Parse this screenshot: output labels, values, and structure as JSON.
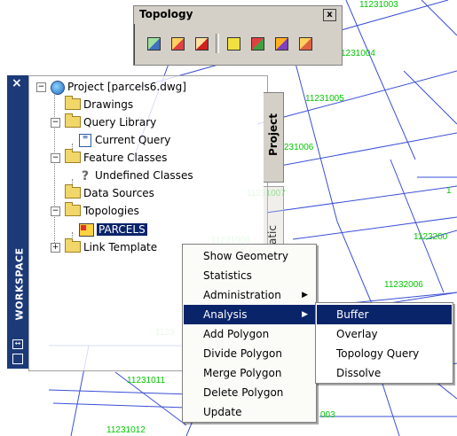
{
  "map": {
    "parcel_labels": [
      "11231003",
      "1231004",
      "11231005",
      "231006",
      "11231007",
      "11231008",
      "1123200",
      "11232006",
      "11231011",
      "1123",
      "11231012",
      "1",
      "003"
    ]
  },
  "topology_toolbar": {
    "title": "Topology",
    "close_label": "x",
    "buttons": [
      "topology-new-icon",
      "topology-edit-icon",
      "topology-delete-icon",
      "topology-show-icon",
      "topology-polygon-icon",
      "topology-network-icon",
      "topology-query-icon"
    ]
  },
  "workspace": {
    "title": "WORKSPACE",
    "close_label": "×",
    "tabs": {
      "project": "Project",
      "schematic": "atic"
    },
    "tree": {
      "root": "Project [parcels6.dwg]",
      "drawings": "Drawings",
      "query_library": "Query Library",
      "current_query": "Current Query",
      "feature_classes": "Feature Classes",
      "undefined_classes": "Undefined Classes",
      "data_sources": "Data Sources",
      "topologies": "Topologies",
      "parcels": "PARCELS",
      "link_templates": "Link Template"
    }
  },
  "context_menu": {
    "items": [
      "Show Geometry",
      "Statistics",
      "Administration",
      "Analysis",
      "Add Polygon",
      "Divide Polygon",
      "Merge Polygon",
      "Delete Polygon",
      "Update"
    ],
    "highlighted": "Analysis"
  },
  "submenu": {
    "items": [
      "Buffer",
      "Overlay",
      "Topology Query",
      "Dissolve"
    ],
    "highlighted": "Buffer"
  },
  "colors": {
    "parcel_label": "#00c800",
    "map_line": "#3a4fd6",
    "selection": "#0a246a"
  }
}
